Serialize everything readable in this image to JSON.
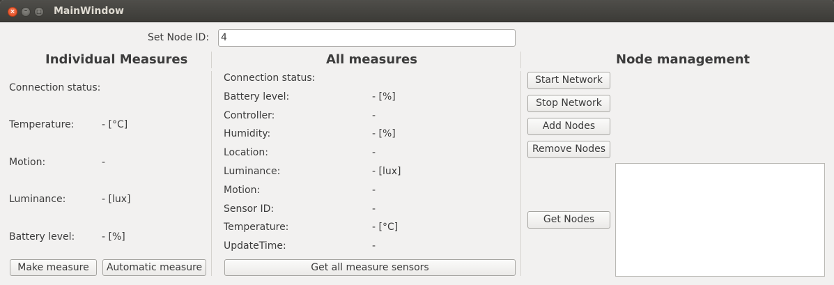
{
  "window": {
    "title": "MainWindow"
  },
  "node_id": {
    "label": "Set Node ID:",
    "value": "4"
  },
  "individual": {
    "heading": "Individual Measures",
    "connection_label": "Connection status:",
    "rows": [
      {
        "label": "Temperature:",
        "value": "- [°C]"
      },
      {
        "label": "Motion:",
        "value": "-"
      },
      {
        "label": "Luminance:",
        "value": "- [lux]"
      },
      {
        "label": "Battery level:",
        "value": "- [%]"
      }
    ],
    "make_measure": "Make measure",
    "automatic_measure": "Automatic measure"
  },
  "all": {
    "heading": "All measures",
    "connection_label": "Connection status:",
    "rows": [
      {
        "label": "Battery level:",
        "value": "- [%]"
      },
      {
        "label": "Controller:",
        "value": "-"
      },
      {
        "label": "Humidity:",
        "value": "- [%]"
      },
      {
        "label": "Location:",
        "value": "-"
      },
      {
        "label": "Luminance:",
        "value": "- [lux]"
      },
      {
        "label": "Motion:",
        "value": "-"
      },
      {
        "label": "Sensor ID:",
        "value": "-"
      },
      {
        "label": "Temperature:",
        "value": "- [°C]"
      },
      {
        "label": "UpdateTime:",
        "value": "-"
      }
    ],
    "get_all": "Get all measure sensors"
  },
  "node_mgmt": {
    "heading": "Node management",
    "start_network": "Start Network",
    "stop_network": "Stop Network",
    "add_nodes": "Add Nodes",
    "remove_nodes": "Remove Nodes",
    "get_nodes": "Get Nodes"
  },
  "icons": {
    "close": "close-icon",
    "minimize": "minimize-icon",
    "maximize": "maximize-icon"
  }
}
